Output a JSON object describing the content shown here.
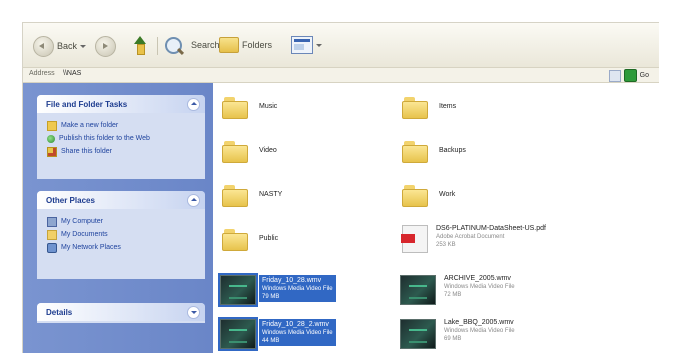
{
  "toolbar": {
    "back_label": "Back",
    "search_label": "Search",
    "folders_label": "Folders"
  },
  "address": {
    "label": "Address",
    "value": "\\\\NAS",
    "go_label": "Go"
  },
  "task_pane": {
    "file_tasks": {
      "title": "File and Folder Tasks",
      "items": [
        "Make a new folder",
        "Publish this folder to the Web",
        "Share this folder"
      ]
    },
    "other_places": {
      "title": "Other Places",
      "items": [
        "My Computer",
        "My Documents",
        "My Network Places"
      ]
    },
    "details": {
      "title": "Details"
    }
  },
  "files": {
    "col1": [
      {
        "type": "folder",
        "name": "Music"
      },
      {
        "type": "folder",
        "name": "Video"
      },
      {
        "type": "folder",
        "name": "NASTY"
      },
      {
        "type": "folder",
        "name": "Public"
      },
      {
        "type": "video",
        "name": "Friday_10_28.wmv",
        "meta1": "Windows Media Video File",
        "meta2": "79 MB",
        "selected": true
      },
      {
        "type": "video",
        "name": "Friday_10_28_2.wmv",
        "meta1": "Windows Media Video File",
        "meta2": "44 MB",
        "selected": true
      }
    ],
    "col2": [
      {
        "type": "folder",
        "name": "Items"
      },
      {
        "type": "folder",
        "name": "Backups"
      },
      {
        "type": "folder",
        "name": "Work"
      },
      {
        "type": "pdf",
        "name": "DS6-PLATINUM-DataSheet-US.pdf",
        "meta1": "Adobe Acrobat Document",
        "meta2": "253 KB"
      },
      {
        "type": "video",
        "name": "ARCHIVE_2005.wmv",
        "meta1": "Windows Media Video File",
        "meta2": "72 MB"
      },
      {
        "type": "video",
        "name": "Lake_BBQ_2005.wmv",
        "meta1": "Windows Media Video File",
        "meta2": "69 MB"
      }
    ]
  }
}
